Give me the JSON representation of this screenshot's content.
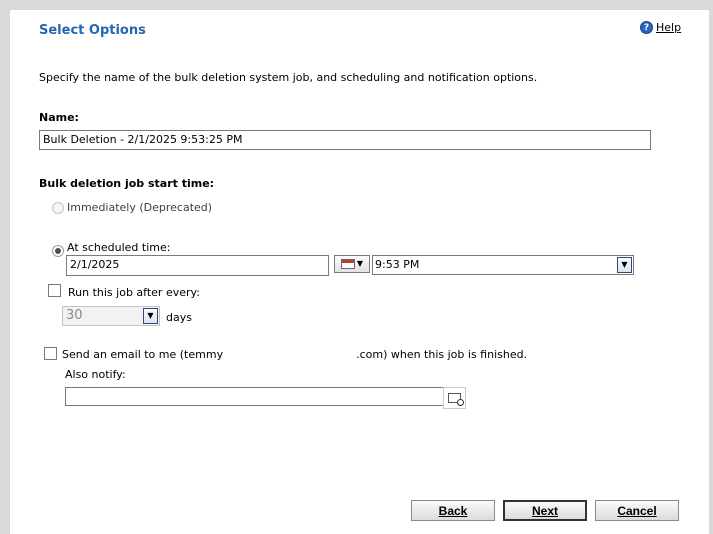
{
  "dialog": {
    "title": "Select Options",
    "help_label": "Help",
    "description": "Specify the name of the bulk deletion system job, and scheduling and notification options."
  },
  "name_field": {
    "label": "Name:",
    "value": "Bulk Deletion - 2/1/2025 9:53:25 PM"
  },
  "schedule": {
    "label": "Bulk deletion job start time:",
    "immediately_label": "Immediately (Deprecated)",
    "scheduled_label": "At scheduled time:",
    "date_value": "2/1/2025",
    "time_value": "9:53 PM",
    "selected": "scheduled"
  },
  "recurrence": {
    "label": "Run this job after every:",
    "days_value": "30",
    "days_unit": "days",
    "checked": false
  },
  "email": {
    "label_prefix": "Send an email to me (temmy",
    "label_suffix": ".com) when this job is finished.",
    "checked": false,
    "also_notify_label": "Also notify:",
    "also_notify_value": ""
  },
  "buttons": {
    "back": "Back",
    "next": "Next",
    "cancel": "Cancel"
  },
  "icons": {
    "help": "help-circle-icon",
    "calendar": "calendar-icon",
    "lookup": "lookup-icon"
  }
}
